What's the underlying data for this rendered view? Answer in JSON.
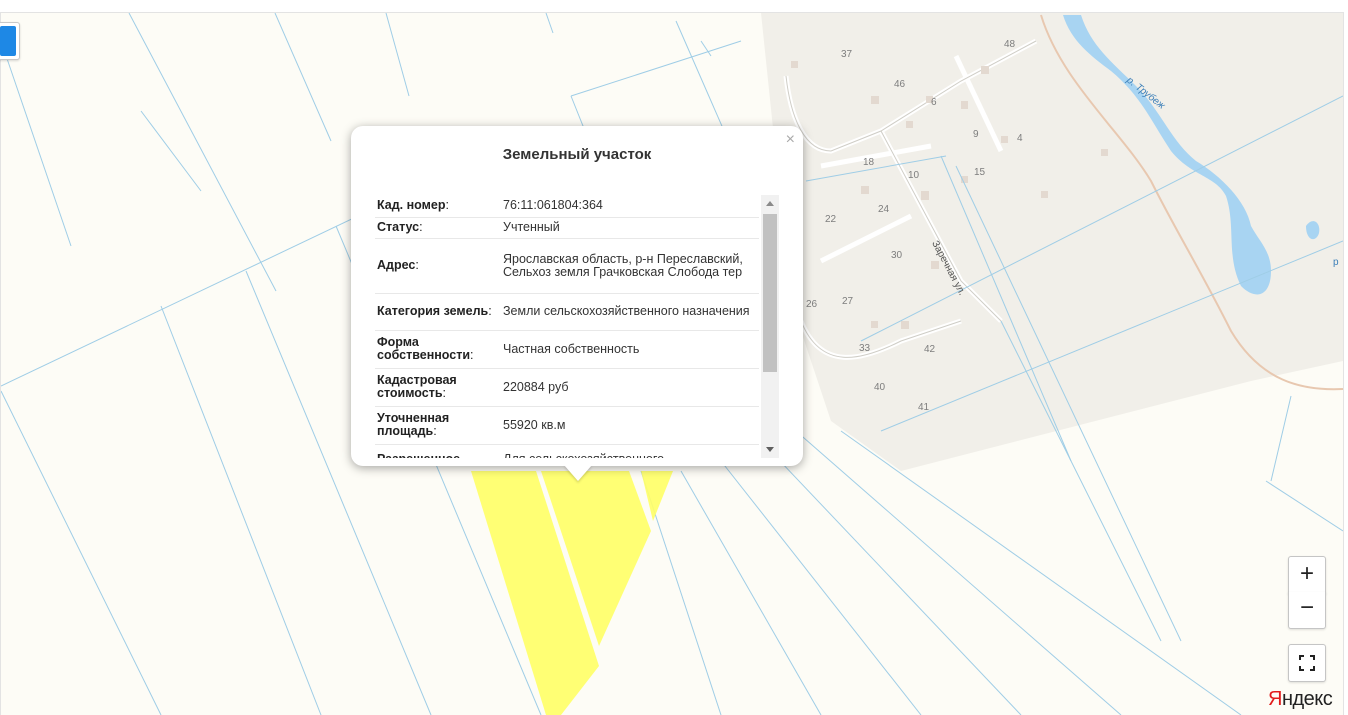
{
  "balloon": {
    "title": "Земельный участок",
    "close_glyph": "×",
    "rows": [
      {
        "key": "Кад. номер",
        "value": "76:11:061804:364"
      },
      {
        "key": "Статус",
        "value": "Учтенный"
      },
      {
        "key": "Адрес",
        "value": "Ярославская область, р-н Переславский, Сельхоз земля Грачковская Слобода тер"
      },
      {
        "key": "Категория земель",
        "value": "Земли сельскохозяйственного назначения"
      },
      {
        "key": "Форма собственности",
        "value": "Частная собственность"
      },
      {
        "key": "Кадастровая стоимость",
        "value": "220884 руб"
      },
      {
        "key": "Уточненная площадь",
        "value": "55920 кв.м"
      },
      {
        "key": "Разрешенное",
        "value": "Для сельскохозяйственного"
      }
    ]
  },
  "map": {
    "house_numbers": [
      "37",
      "48",
      "46",
      "6",
      "9",
      "4",
      "18",
      "10",
      "15",
      "22",
      "24",
      "30",
      "26",
      "27",
      "33",
      "42",
      "40",
      "41"
    ],
    "street_label": "Заречная ул.",
    "river_label": "р. Трубеж",
    "edge_label": "р",
    "colors": {
      "background": "#fdfcf6",
      "parcel_line": "#9fcde6",
      "selected_parcel": "#ffff66",
      "settlement": "#f0eee8",
      "river": "#a8d4f2",
      "accent": "#1e88e5"
    }
  },
  "controls": {
    "zoom_in": "+",
    "zoom_out": "−",
    "fullscreen": "fullscreen-icon",
    "layers": "layers-icon"
  },
  "logo": {
    "first": "Я",
    "rest": "ндекс"
  }
}
